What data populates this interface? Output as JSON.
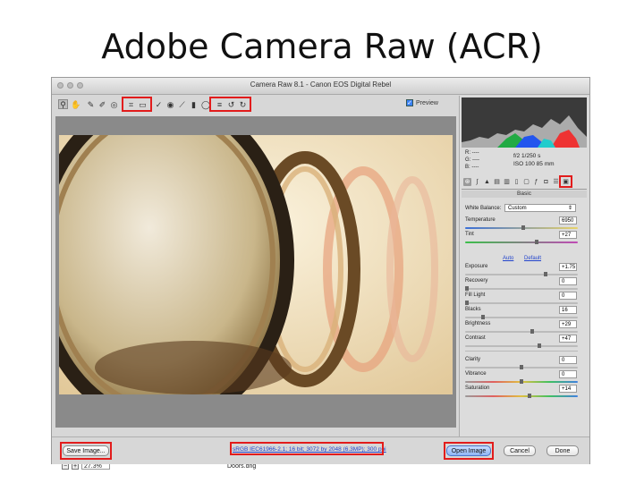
{
  "slide": {
    "title": "Adobe Camera Raw (ACR)"
  },
  "window": {
    "title": "Camera Raw 8.1  -  Canon EOS Digital Rebel"
  },
  "toolbar": {
    "tools": [
      "zoom-icon",
      "hand-icon",
      "white-balance-icon",
      "color-sampler-icon",
      "targeted-adjust-icon",
      "crop-icon",
      "straighten-icon",
      "spot-removal-icon",
      "red-eye-icon",
      "adjustment-brush-icon",
      "graduated-filter-icon",
      "radial-filter-icon",
      "preferences-icon",
      "rotate-left-icon",
      "rotate-right-icon"
    ],
    "preview_label": "Preview"
  },
  "readout": {
    "r": "R:",
    "g": "G:",
    "b": "B:",
    "dash": "----",
    "aperture_shutter": "f/2   1/250 s",
    "iso_focal": "ISO 100   85 mm"
  },
  "panel": {
    "section": "Basic",
    "white_balance_label": "White Balance:",
    "white_balance_value": "Custom",
    "auto": "Auto",
    "default": "Default",
    "sliders": [
      {
        "label": "Temperature",
        "value": "6950",
        "pos": 0.52
      },
      {
        "label": "Tint",
        "value": "+27",
        "pos": 0.64
      },
      {
        "label": "Exposure",
        "value": "+1.75",
        "pos": 0.72
      },
      {
        "label": "Recovery",
        "value": "0",
        "pos": 0.0
      },
      {
        "label": "Fill Light",
        "value": "0",
        "pos": 0.0
      },
      {
        "label": "Blacks",
        "value": "16",
        "pos": 0.15
      },
      {
        "label": "Brightness",
        "value": "+29",
        "pos": 0.6
      },
      {
        "label": "Contrast",
        "value": "+47",
        "pos": 0.66
      },
      {
        "label": "Clarity",
        "value": "0",
        "pos": 0.5
      },
      {
        "label": "Vibrance",
        "value": "0",
        "pos": 0.5
      },
      {
        "label": "Saturation",
        "value": "+14",
        "pos": 0.57
      }
    ]
  },
  "canvas": {
    "zoom": "27.3%",
    "filename": "Doors.dng",
    "warning": "!"
  },
  "footer": {
    "save_image": "Save Image...",
    "workflow_link": "sRGB IEC61966-2.1; 16 bit; 3072 by 2048 (6.3MP); 300 ppi",
    "open_image": "Open Image",
    "cancel": "Cancel",
    "done": "Done"
  },
  "colors": {
    "highlight": "#e21c1c",
    "link": "#2244cc",
    "primary_button": "#8fb5f5"
  }
}
